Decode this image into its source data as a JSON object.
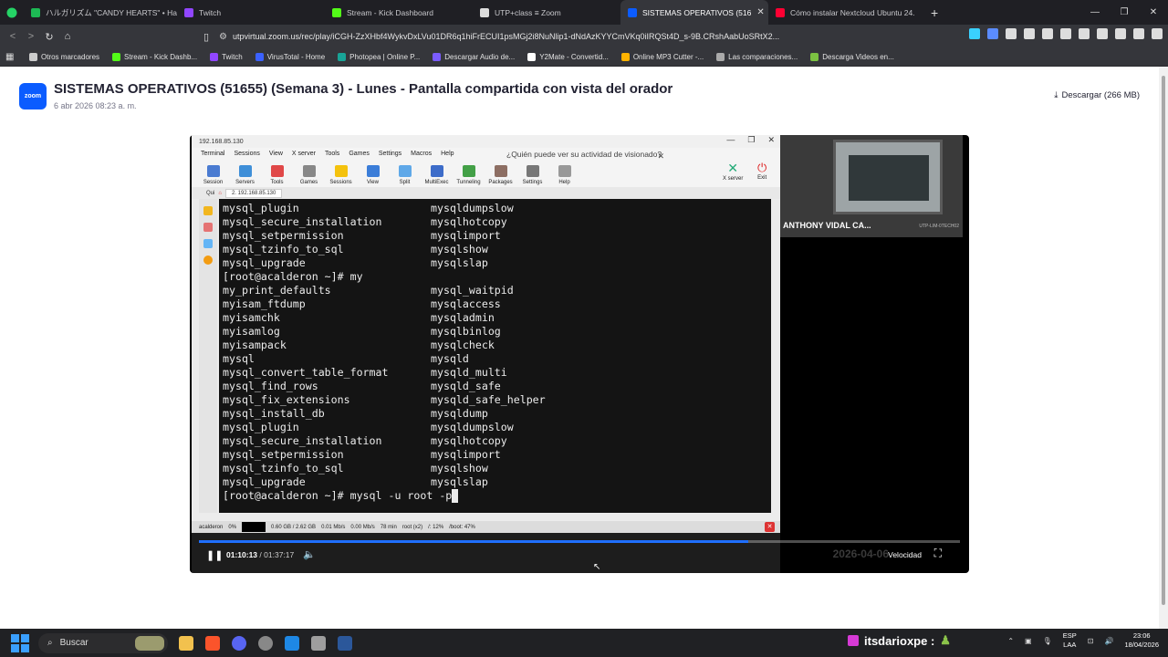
{
  "browser": {
    "tabs": [
      {
        "label": "ハルガリズム \"CANDY HEARTS\" • Ha",
        "color": "#1db954"
      },
      {
        "label": "Twitch",
        "color": "#9146ff"
      },
      {
        "label": "Stream - Kick Dashboard",
        "color": "#53fc18"
      },
      {
        "label": "UTP+class ≡ Zoom",
        "color": "#dddddd"
      },
      {
        "label": "SISTEMAS OPERATIVOS (516",
        "color": "#0b5cff"
      },
      {
        "label": "Cómo instalar Nextcloud Ubuntu 24.",
        "color": "#ff0033"
      }
    ],
    "tab_close": "✕",
    "new_tab": "+",
    "url": "utpvirtual.zoom.us/rec/play/iCGH-ZzXHbf4WykvDxLVu01DR6q1hiFrECUI1psMGj2i8NuNlip1-dNdAzKYYCmVKq0iIRQSt4D_s-9B.CRshAabUoSRtX2...",
    "bookmarks": [
      {
        "label": "Otros marcadores",
        "color": "#cccccc"
      },
      {
        "label": "Stream - Kick Dashb...",
        "color": "#53fc18"
      },
      {
        "label": "Twitch",
        "color": "#9146ff"
      },
      {
        "label": "VirusTotal - Home",
        "color": "#3b61ff"
      },
      {
        "label": "Photopea | Online P...",
        "color": "#18a497"
      },
      {
        "label": "Descargar Audio de...",
        "color": "#7b5cff"
      },
      {
        "label": "Y2Mate - Convertid...",
        "color": "#ffffff"
      },
      {
        "label": "Online MP3 Cutter -...",
        "color": "#ffb300"
      },
      {
        "label": "Las comparaciones...",
        "color": "#aaaaaa"
      },
      {
        "label": "Descarga Videos en...",
        "color": "#7cc242"
      }
    ]
  },
  "page": {
    "logo": "zoom",
    "title": "SISTEMAS OPERATIVOS (51655) (Semana 3) - Lunes - Pantalla compartida con vista del orador",
    "date": "6 abr 2026 08:23 a. m.",
    "download": "Descargar (266 MB)"
  },
  "share": {
    "window_title": "192.168.85.130",
    "menu": [
      "Terminal",
      "Sessions",
      "View",
      "X server",
      "Tools",
      "Games",
      "Settings",
      "Macros",
      "Help"
    ],
    "toolbar": [
      "Session",
      "Servers",
      "Tools",
      "Games",
      "Sessions",
      "View",
      "Split",
      "MultiExec",
      "Tunneling",
      "Packages",
      "Settings",
      "Help"
    ],
    "tip": "¿Quién puede ver su actividad de visionado?",
    "xserver": "X server",
    "exit": "Exit",
    "quick": "Qui",
    "tab": "2. 192.168.85.130",
    "terminal_lines": [
      [
        "mysql_plugin",
        "mysqldumpslow"
      ],
      [
        "mysql_secure_installation",
        "mysqlhotcopy"
      ],
      [
        "mysql_setpermission",
        "mysqlimport"
      ],
      [
        "mysql_tzinfo_to_sql",
        "mysqlshow"
      ],
      [
        "mysql_upgrade",
        "mysqlslap"
      ],
      [
        "[root@acalderon ~]# my",
        ""
      ],
      [
        "my_print_defaults",
        "mysql_waitpid"
      ],
      [
        "myisam_ftdump",
        "mysqlaccess"
      ],
      [
        "myisamchk",
        "mysqladmin"
      ],
      [
        "myisamlog",
        "mysqlbinlog"
      ],
      [
        "myisampack",
        "mysqlcheck"
      ],
      [
        "mysql",
        "mysqld"
      ],
      [
        "mysql_convert_table_format",
        "mysqld_multi"
      ],
      [
        "mysql_find_rows",
        "mysqld_safe"
      ],
      [
        "mysql_fix_extensions",
        "mysqld_safe_helper"
      ],
      [
        "mysql_install_db",
        "mysqldump"
      ],
      [
        "mysql_plugin",
        "mysqldumpslow"
      ],
      [
        "mysql_secure_installation",
        "mysqlhotcopy"
      ],
      [
        "mysql_setpermission",
        "mysqlimport"
      ],
      [
        "mysql_tzinfo_to_sql",
        "mysqlshow"
      ],
      [
        "mysql_upgrade",
        "mysqlslap"
      ]
    ],
    "prompt": "[root@acalderon ~]# mysql -u root -p",
    "statusbar": [
      "acalderon",
      "0%",
      "0.60 GB / 2.62 GB",
      "0.01 Mb/s",
      "0.00 Mb/s",
      "78 min",
      "root (x2)",
      "/: 12%",
      "/boot: 47%"
    ]
  },
  "speaker": {
    "name": "ANTHONY VIDAL CA...",
    "tag": "UTP-LIM-0TECH02"
  },
  "player": {
    "time_current": "01:10:13",
    "time_total": "01:37:17",
    "progress": 0.7217,
    "overlay_date": "2026-04-06",
    "speed_label": "Velocidad"
  },
  "taskbar": {
    "search": "Buscar",
    "live_user": "itsdarioxpe :",
    "lang": "ESP",
    "lang2": "LAA",
    "time": "23:06",
    "date": "18/04/2026"
  }
}
